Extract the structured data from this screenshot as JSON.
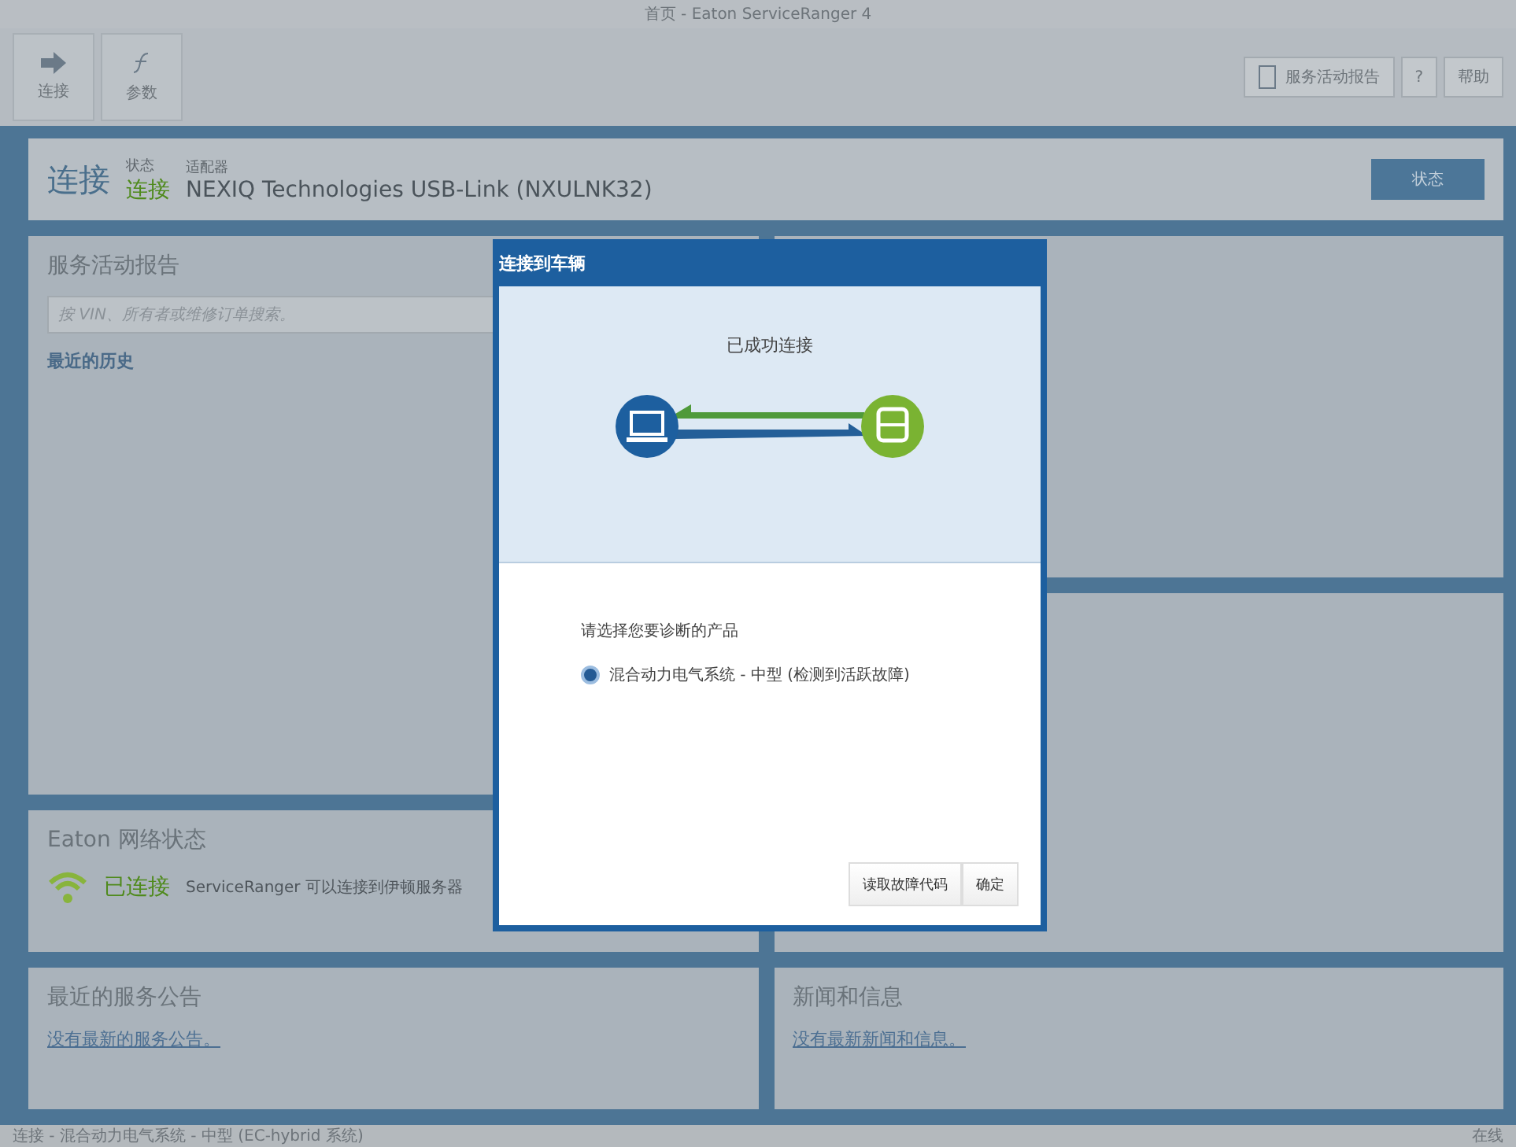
{
  "window": {
    "title": "首页 - Eaton ServiceRanger 4"
  },
  "toolbar": {
    "items": [
      {
        "label": "连接"
      },
      {
        "label": "参数"
      }
    ],
    "report_button": "服务活动报告",
    "help_button": "?",
    "help_menu": "帮助"
  },
  "connection": {
    "title": "连接",
    "status_label": "状态",
    "status": "连接",
    "adapter_label": "适配器",
    "adapter": "NEXIQ Technologies USB-Link (NXULNK32)",
    "button": "状态"
  },
  "service_report": {
    "title": "服务活动报告",
    "search": {
      "placeholder": "按 VIN、所有者或维修订单搜索。"
    },
    "link": "最近的历史"
  },
  "network": {
    "title": "Eaton 网络状态",
    "status": "已连接",
    "message": "ServiceRanger 可以连接到伊顿服务器"
  },
  "bulletins": {
    "title": "最近的服务公告",
    "link": "没有最新的服务公告。"
  },
  "news": {
    "title": "新闻和信息",
    "link": "没有最新新闻和信息。"
  },
  "status_bar": {
    "left": "连接 - 混合动力电气系统 - 中型 (EC-hybrid 系统)",
    "right": "在线"
  },
  "dialog": {
    "title": "连接到车辆",
    "message": "已成功连接",
    "prompt": "请选择您要诊断的产品",
    "options": [
      {
        "label": "混合动力电气系统 - 中型 (检测到活跃故障)",
        "selected": true
      }
    ],
    "buttons": [
      "读取故障代码",
      "确定"
    ]
  }
}
